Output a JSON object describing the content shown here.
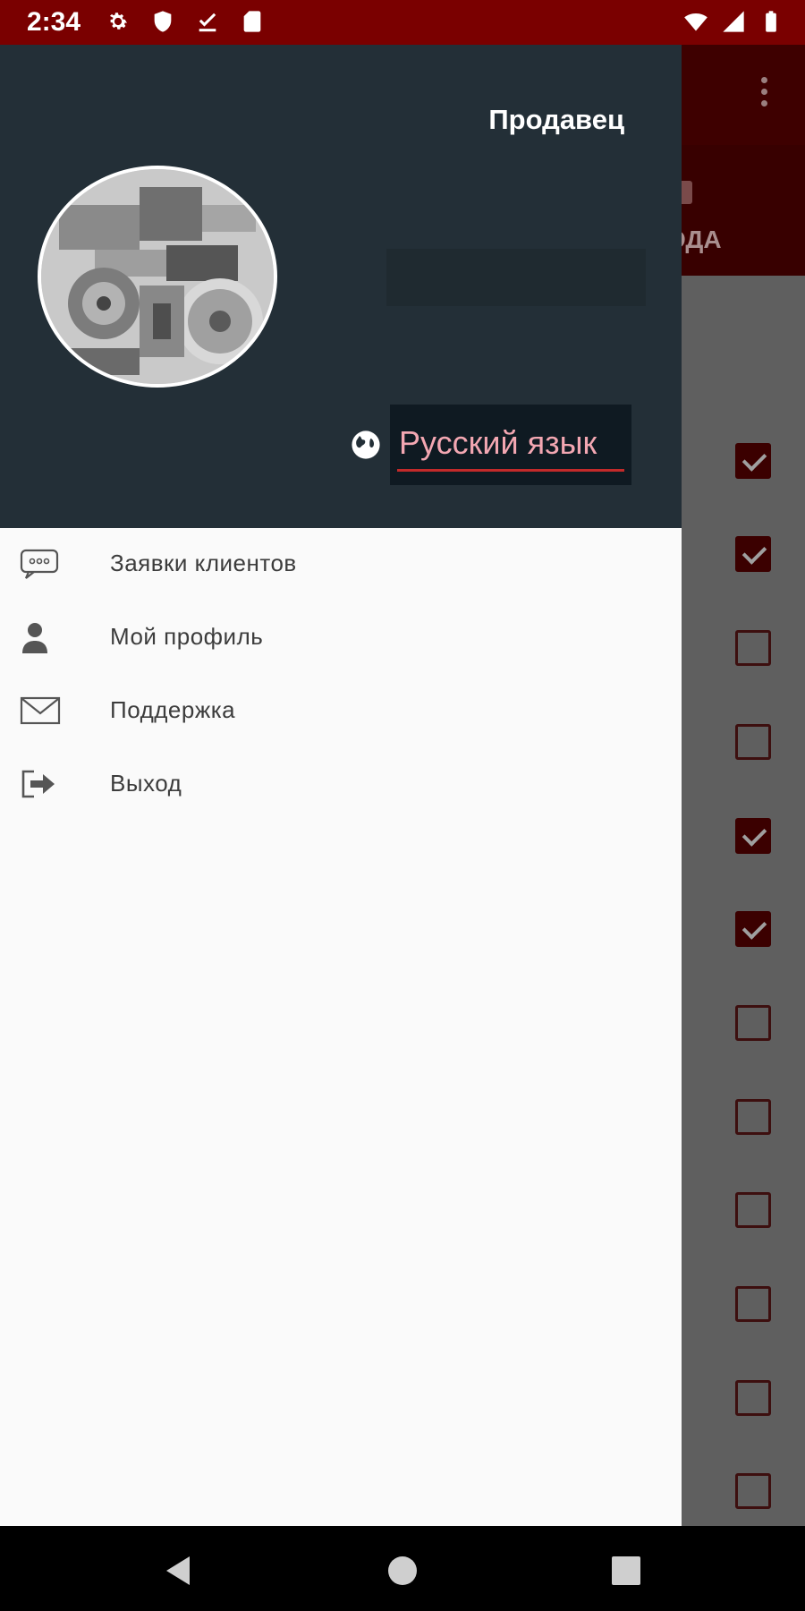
{
  "status_bar": {
    "time": "2:34",
    "left_icons": [
      "gear-icon",
      "shield-icon",
      "download-done-icon",
      "sd-card-icon"
    ],
    "right_icons": [
      "wifi-icon",
      "cell-signal-icon",
      "battery-icon"
    ]
  },
  "drawer": {
    "role_title": "Продавец",
    "avatar": "engine-parts-photo",
    "language": {
      "icon": "globe-icon",
      "selected": "Русский язык"
    },
    "menu": [
      {
        "label": "Заявки клиентов",
        "icon": "chat-bubble-icon"
      },
      {
        "label": "Мой профиль",
        "icon": "person-icon"
      },
      {
        "label": "Поддержка",
        "icon": "mail-icon"
      },
      {
        "label": "Выход",
        "icon": "exit-icon"
      }
    ]
  },
  "background_app": {
    "tab_label_partial": "ОДА",
    "checkbox_states": [
      true,
      true,
      false,
      false,
      true,
      true,
      false,
      false,
      false,
      false,
      false,
      false
    ]
  },
  "nav_bar": {
    "buttons": [
      "back-icon",
      "home-icon",
      "recents-icon"
    ]
  },
  "colors": {
    "status_bar": "#7a0000",
    "drawer_header": "#232f37",
    "accent": "#c22a2a",
    "language_text": "#f3a7b2"
  }
}
